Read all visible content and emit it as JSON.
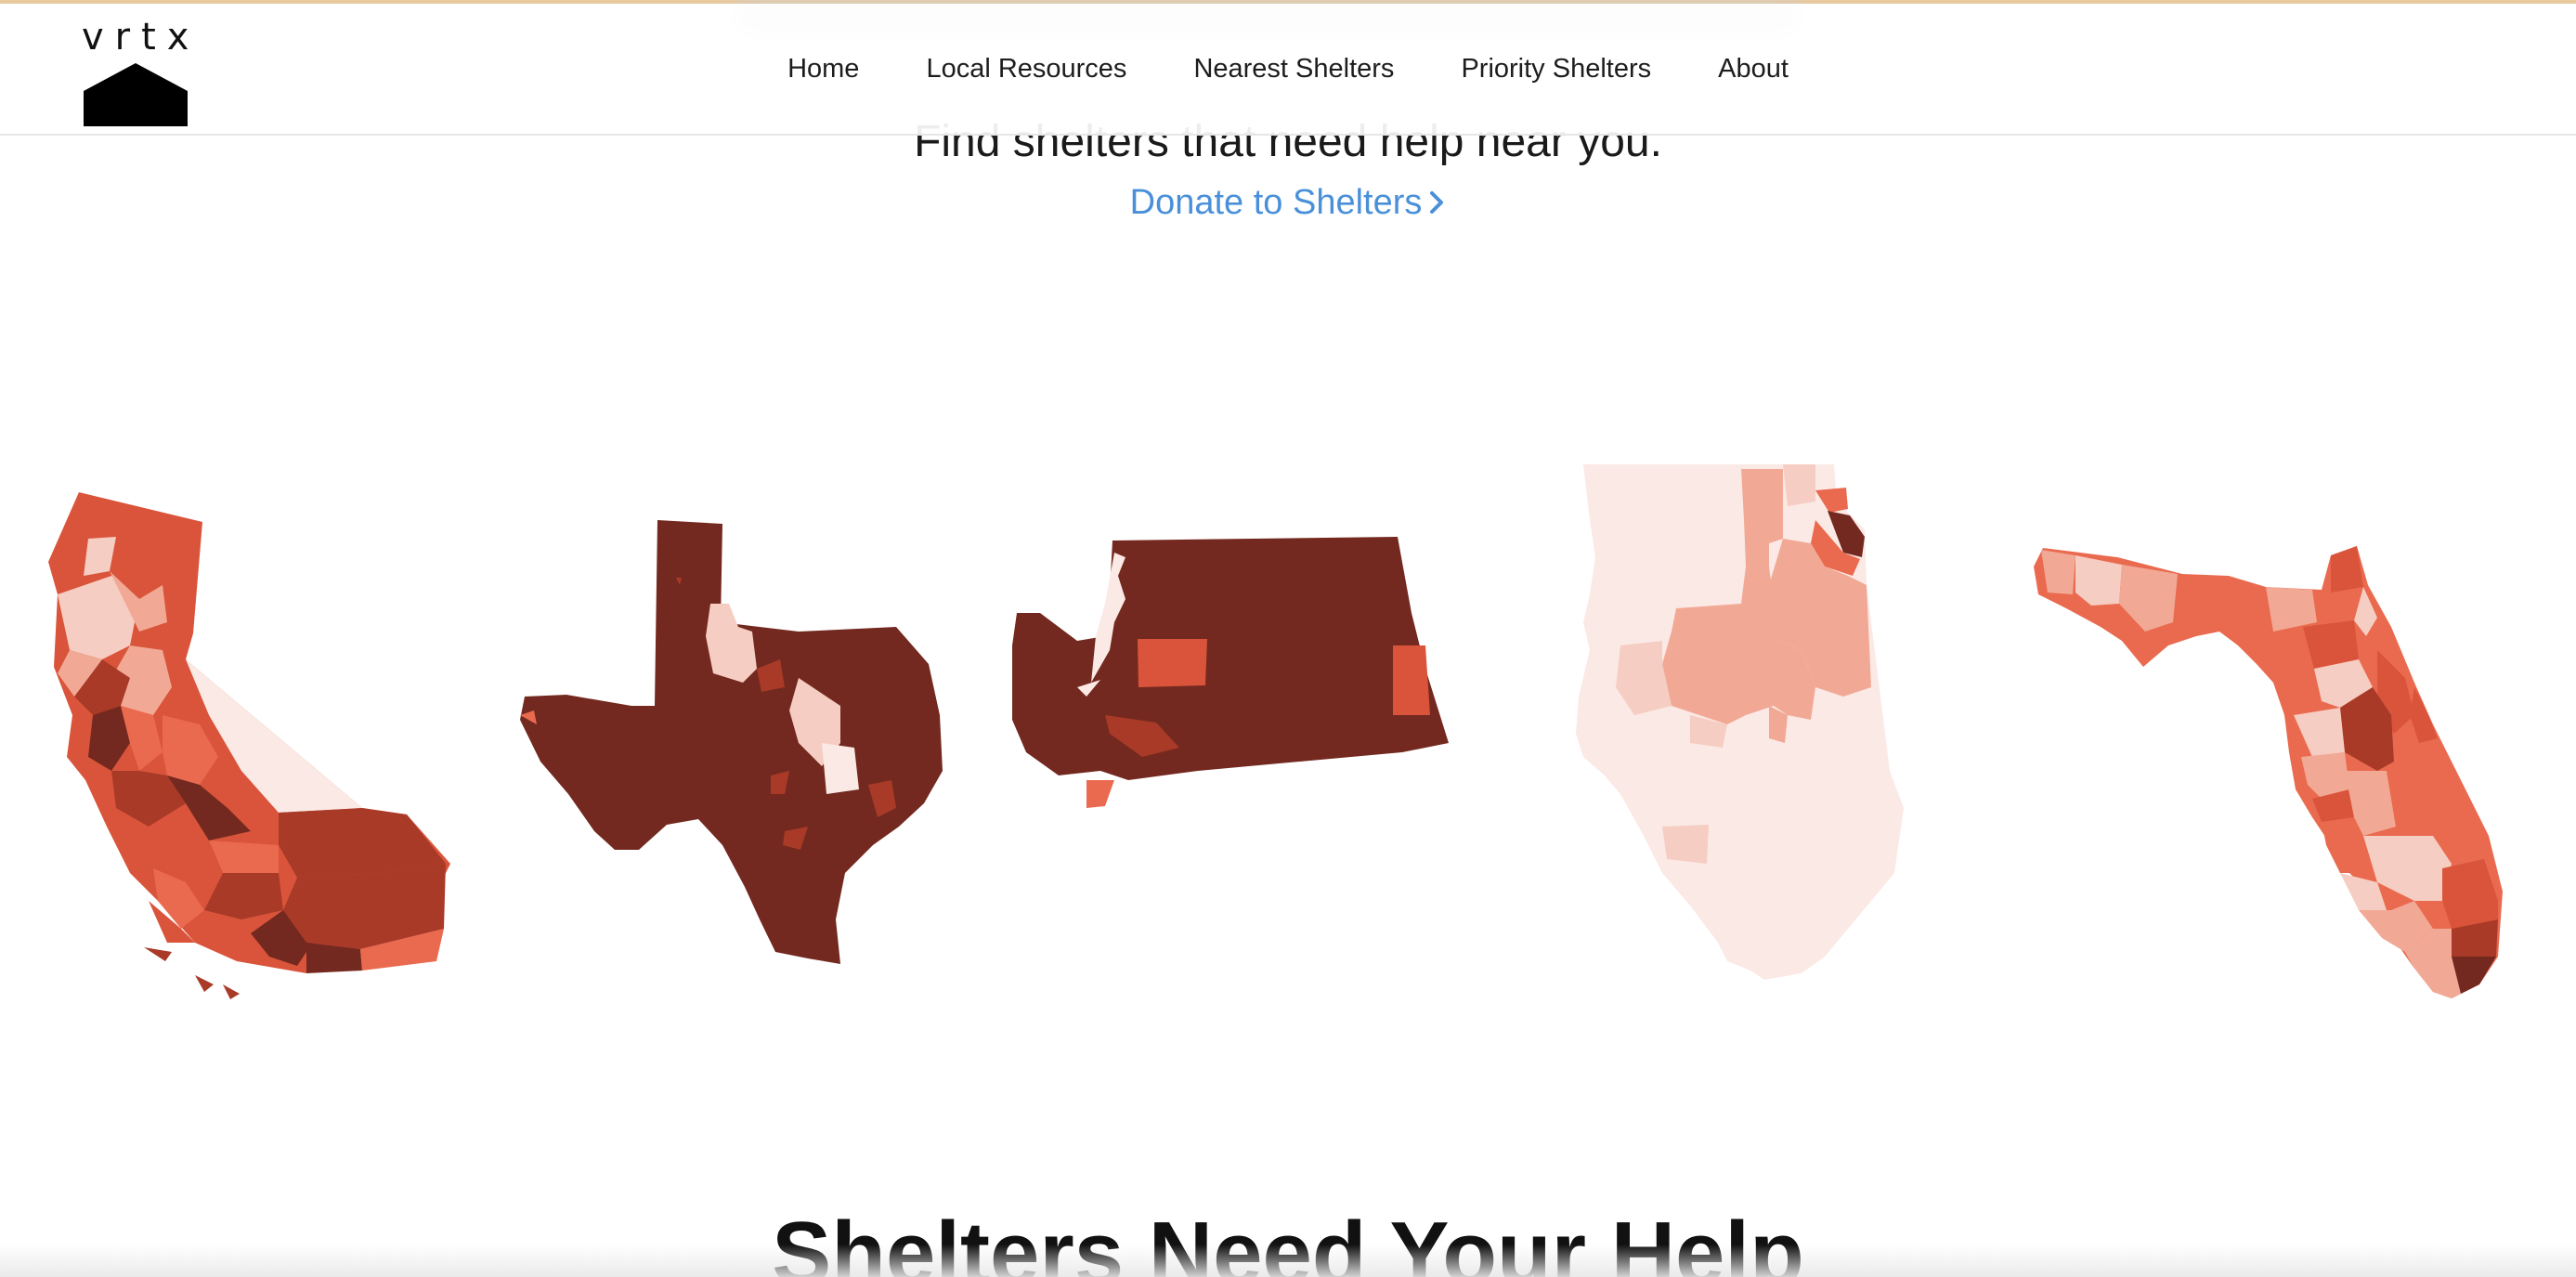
{
  "brand": {
    "logo_text": "vrtx",
    "logo_icon": "house-icon"
  },
  "nav": {
    "items": [
      {
        "label": "Home"
      },
      {
        "label": "Local Resources"
      },
      {
        "label": "Nearest Shelters"
      },
      {
        "label": "Priority Shelters"
      },
      {
        "label": "About"
      }
    ]
  },
  "hero": {
    "tagline": "Find shelters that need help near you.",
    "donate_label": "Donate to Shelters",
    "donate_icon": "chevron-right-icon"
  },
  "maps": {
    "states": [
      "California",
      "Texas",
      "Washington",
      "Illinois",
      "Florida"
    ],
    "palette": [
      "#fbe9e5",
      "#f6cdc2",
      "#f1a995",
      "#ea6a4f",
      "#d9543a",
      "#a93a28",
      "#73291f"
    ]
  },
  "section": {
    "heading": "Shelters Need Your Help"
  },
  "colors": {
    "link": "#4a90d9",
    "accent_bar": "#e8c9a0",
    "text": "#1a1a1a"
  }
}
